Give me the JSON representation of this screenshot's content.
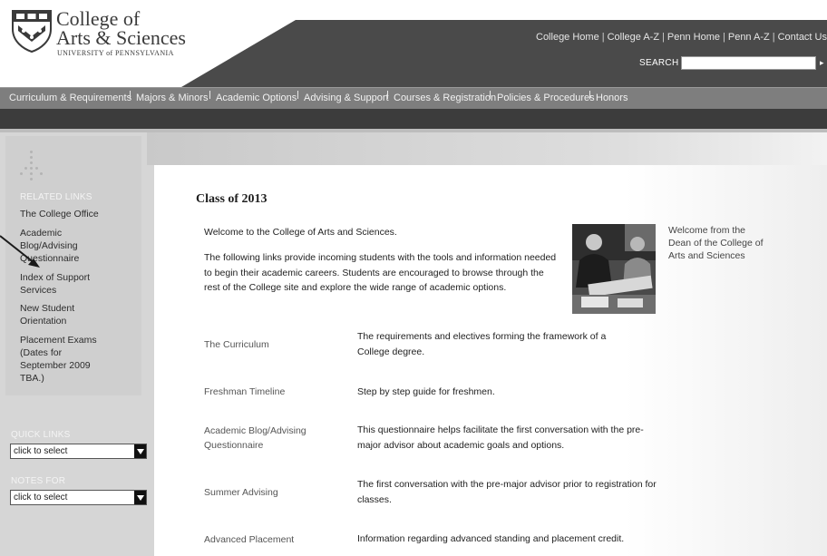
{
  "logo": {
    "line1": "College of",
    "line2": "Arts & Sciences",
    "line3": "UNIVERSITY of PENNSYLVANIA"
  },
  "utility_links": [
    "College Home",
    "College A-Z",
    "Penn Home",
    "Penn A-Z",
    "Contact Us"
  ],
  "utility_separator": "|",
  "search": {
    "label": "SEARCH",
    "value": "",
    "go_glyph": "▸"
  },
  "nav": {
    "items": [
      "Curriculum & Requirements",
      "Majors & Minors",
      "Academic Options",
      "Advising & Support",
      "Courses & Registration",
      "Policies & Procedures",
      "Honors"
    ]
  },
  "sidebar": {
    "related_heading": "RELATED LINKS",
    "links": [
      "The College Office",
      "Academic Blog/Advising Questionnaire",
      "Index of Support Services",
      "New Student Orientation",
      "Placement Exams (Dates for September 2009 TBA.)"
    ],
    "quick_links": {
      "heading": "QUICK LINKS",
      "selected": "click to select"
    },
    "notes_for": {
      "heading": "NOTES FOR",
      "selected": "click to select"
    }
  },
  "main": {
    "title": "Class of 2013",
    "welcome": "Welcome to the College of Arts and Sciences.",
    "intro": "The following links provide incoming students with the tools and information needed to begin their academic careers. Students are encouraged to browse through the rest of the College site and explore the wide range of academic options.",
    "photo_caption": "Welcome from the Dean of the College of Arts and Sciences",
    "rows": [
      {
        "name": "The Curriculum",
        "desc": "The requirements and electives forming the framework of a College degree."
      },
      {
        "name": "Freshman Timeline",
        "desc": "Step by step guide for freshmen."
      },
      {
        "name": "Academic Blog/Advising Questionnaire",
        "desc": "This questionnaire helps facilitate the first conversation with the pre-major advisor about academic goals and options."
      },
      {
        "name": "Summer Advising",
        "desc": "The first conversation with the pre-major advisor prior to registration for classes."
      },
      {
        "name": "Advanced Placement",
        "desc": "Information regarding advanced standing and placement credit."
      }
    ]
  },
  "colors": {
    "header_dark": "#4a4a4a",
    "nav_bar": "#7e7e7e",
    "band": "#3c3c3c",
    "sidebar": "#d6d6d6",
    "content": "#ffffff"
  }
}
